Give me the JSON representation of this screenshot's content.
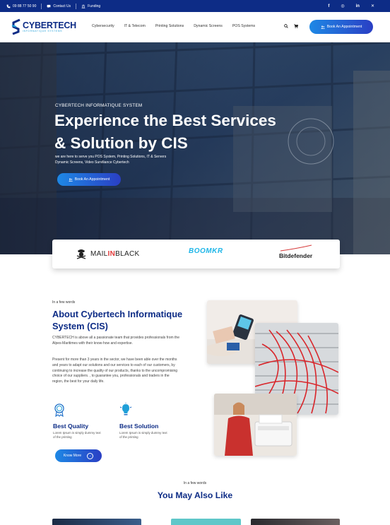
{
  "topbar": {
    "phone": "09 88 77 50 90",
    "contact": "Contact Us",
    "funding": "Funding",
    "socials": [
      "f",
      "◎",
      "in",
      "✕"
    ]
  },
  "header": {
    "brand": "CYBERTECH",
    "tagline": "INFORMATIQUE SYSTEMS",
    "nav": [
      "Cybersecurity",
      "IT & Telecom",
      "Printing Solutions",
      "Dynamic Screens",
      "POS Systems"
    ],
    "cta": "Book An Appointment"
  },
  "hero": {
    "kicker": "CYBERTECH INFORMATIQUE SYSTEM",
    "title_line1": "Experience the Best Services",
    "title_line2": "& Solution by CIS",
    "desc_line1": "we are here to serve you POS System, Printing Solutions, IT & Servers",
    "desc_line2": "Dynamic Screens, Video Surviliance Cybertech",
    "cta": "Book An Appointment"
  },
  "partners": {
    "mailinblack_a": "MAIL",
    "mailinblack_b": "IN",
    "mailinblack_c": "BLACK",
    "boomkr": "BOOMKR",
    "bitdefender": "Bitdefender"
  },
  "about": {
    "kicker": "In a few words",
    "title": "About Cybertech Informatique System (CIS)",
    "p1": "CYBERTECH is above all a passionate team that provides professionals from the Alpes-Maritimes with their know-how and expertise.",
    "p2": "Present for more than 3 years in the sector, we have been able over the months and years to adapt our solutions and our services to each of our customers, by continuing to increase the quality of our products, thanks to the uncompromising choice of our suppliers. , to guarantee you, professionals and traders in the region, the best for your daily life.",
    "features": [
      {
        "title": "Best Quality",
        "desc": "Lorem Ipsum is simply dummy text of the printing",
        "icon": "medal-icon"
      },
      {
        "title": "Best Solution",
        "desc": "Lorem Ipsum is simply dummy text of the printing",
        "icon": "bulb-icon"
      }
    ],
    "cta": "Know More"
  },
  "also_like": {
    "kicker": "In a few words",
    "title": "You May Also Like"
  },
  "colors": {
    "primary": "#0d2c86",
    "accent": "#1f9fd8",
    "gradient_start": "#1e88e5",
    "gradient_end": "#2a3fc4"
  }
}
